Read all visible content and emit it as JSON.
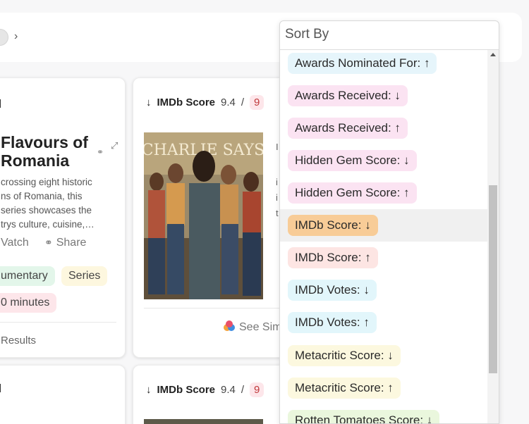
{
  "sort": {
    "title": "Sort By",
    "options": [
      {
        "label": "Awards Nominated For: ↑",
        "bg": "#e6f5fb"
      },
      {
        "label": "Awards Received: ↓",
        "bg": "#fbe3f2"
      },
      {
        "label": "Awards Received: ↑",
        "bg": "#fbe3f2"
      },
      {
        "label": "Hidden Gem Score: ↓",
        "bg": "#fbe3f2"
      },
      {
        "label": "Hidden Gem Score: ↑",
        "bg": "#fbe3f2"
      },
      {
        "label": "IMDb Score: ↓",
        "bg": "#f8cc97",
        "highlighted": true
      },
      {
        "label": "IMDb Score: ↑",
        "bg": "#fde5e3"
      },
      {
        "label": "IMDb Votes: ↓",
        "bg": "#e2f6fb"
      },
      {
        "label": "IMDb Votes: ↑",
        "bg": "#e2f6fb"
      },
      {
        "label": "Metacritic Score: ↓",
        "bg": "#fcf8df"
      },
      {
        "label": "Metacritic Score: ↑",
        "bg": "#fcf8df"
      },
      {
        "label": "Rotten Tomatoes Score: ↓",
        "bg": "#eaf7dd"
      }
    ]
  },
  "card1": {
    "title_line1": "Flavours of",
    "title_line2": "Romania",
    "description": "crossing eight historic\nns of Romania, this\nseries showcases the\ntrys culture, cuisine,…",
    "watch_label": "Vatch",
    "share_label": "Share",
    "tags": [
      "umentary",
      "Series"
    ],
    "duration": "0 minutes",
    "results_label": "Results"
  },
  "card2": {
    "arrow": "↓",
    "score_label": "IMDb Score",
    "score_value": "9.4",
    "separator": "/",
    "score_box": "9",
    "poster_title": "CHARLIE SAYS",
    "side_letters": [
      "I",
      "i",
      "i",
      "t"
    ],
    "see_similar": "See Sim"
  },
  "card4": {
    "arrow": "↓",
    "score_label": "IMDb Score",
    "score_value": "9.4",
    "separator": "/",
    "score_box": "9"
  },
  "colors": {
    "highlight_row": "#f0f0f0",
    "tag_documentary": "#e3f6ea",
    "tag_series": "#fdf7df",
    "tag_duration": "#fde6ea"
  },
  "icons": {
    "nav": "chevron-right-icon",
    "sort_desc": "arrow-down-icon",
    "link": "link-icon",
    "expand": "expand-icon",
    "share": "share-link-icon",
    "similar": "colored-dots-icon"
  }
}
